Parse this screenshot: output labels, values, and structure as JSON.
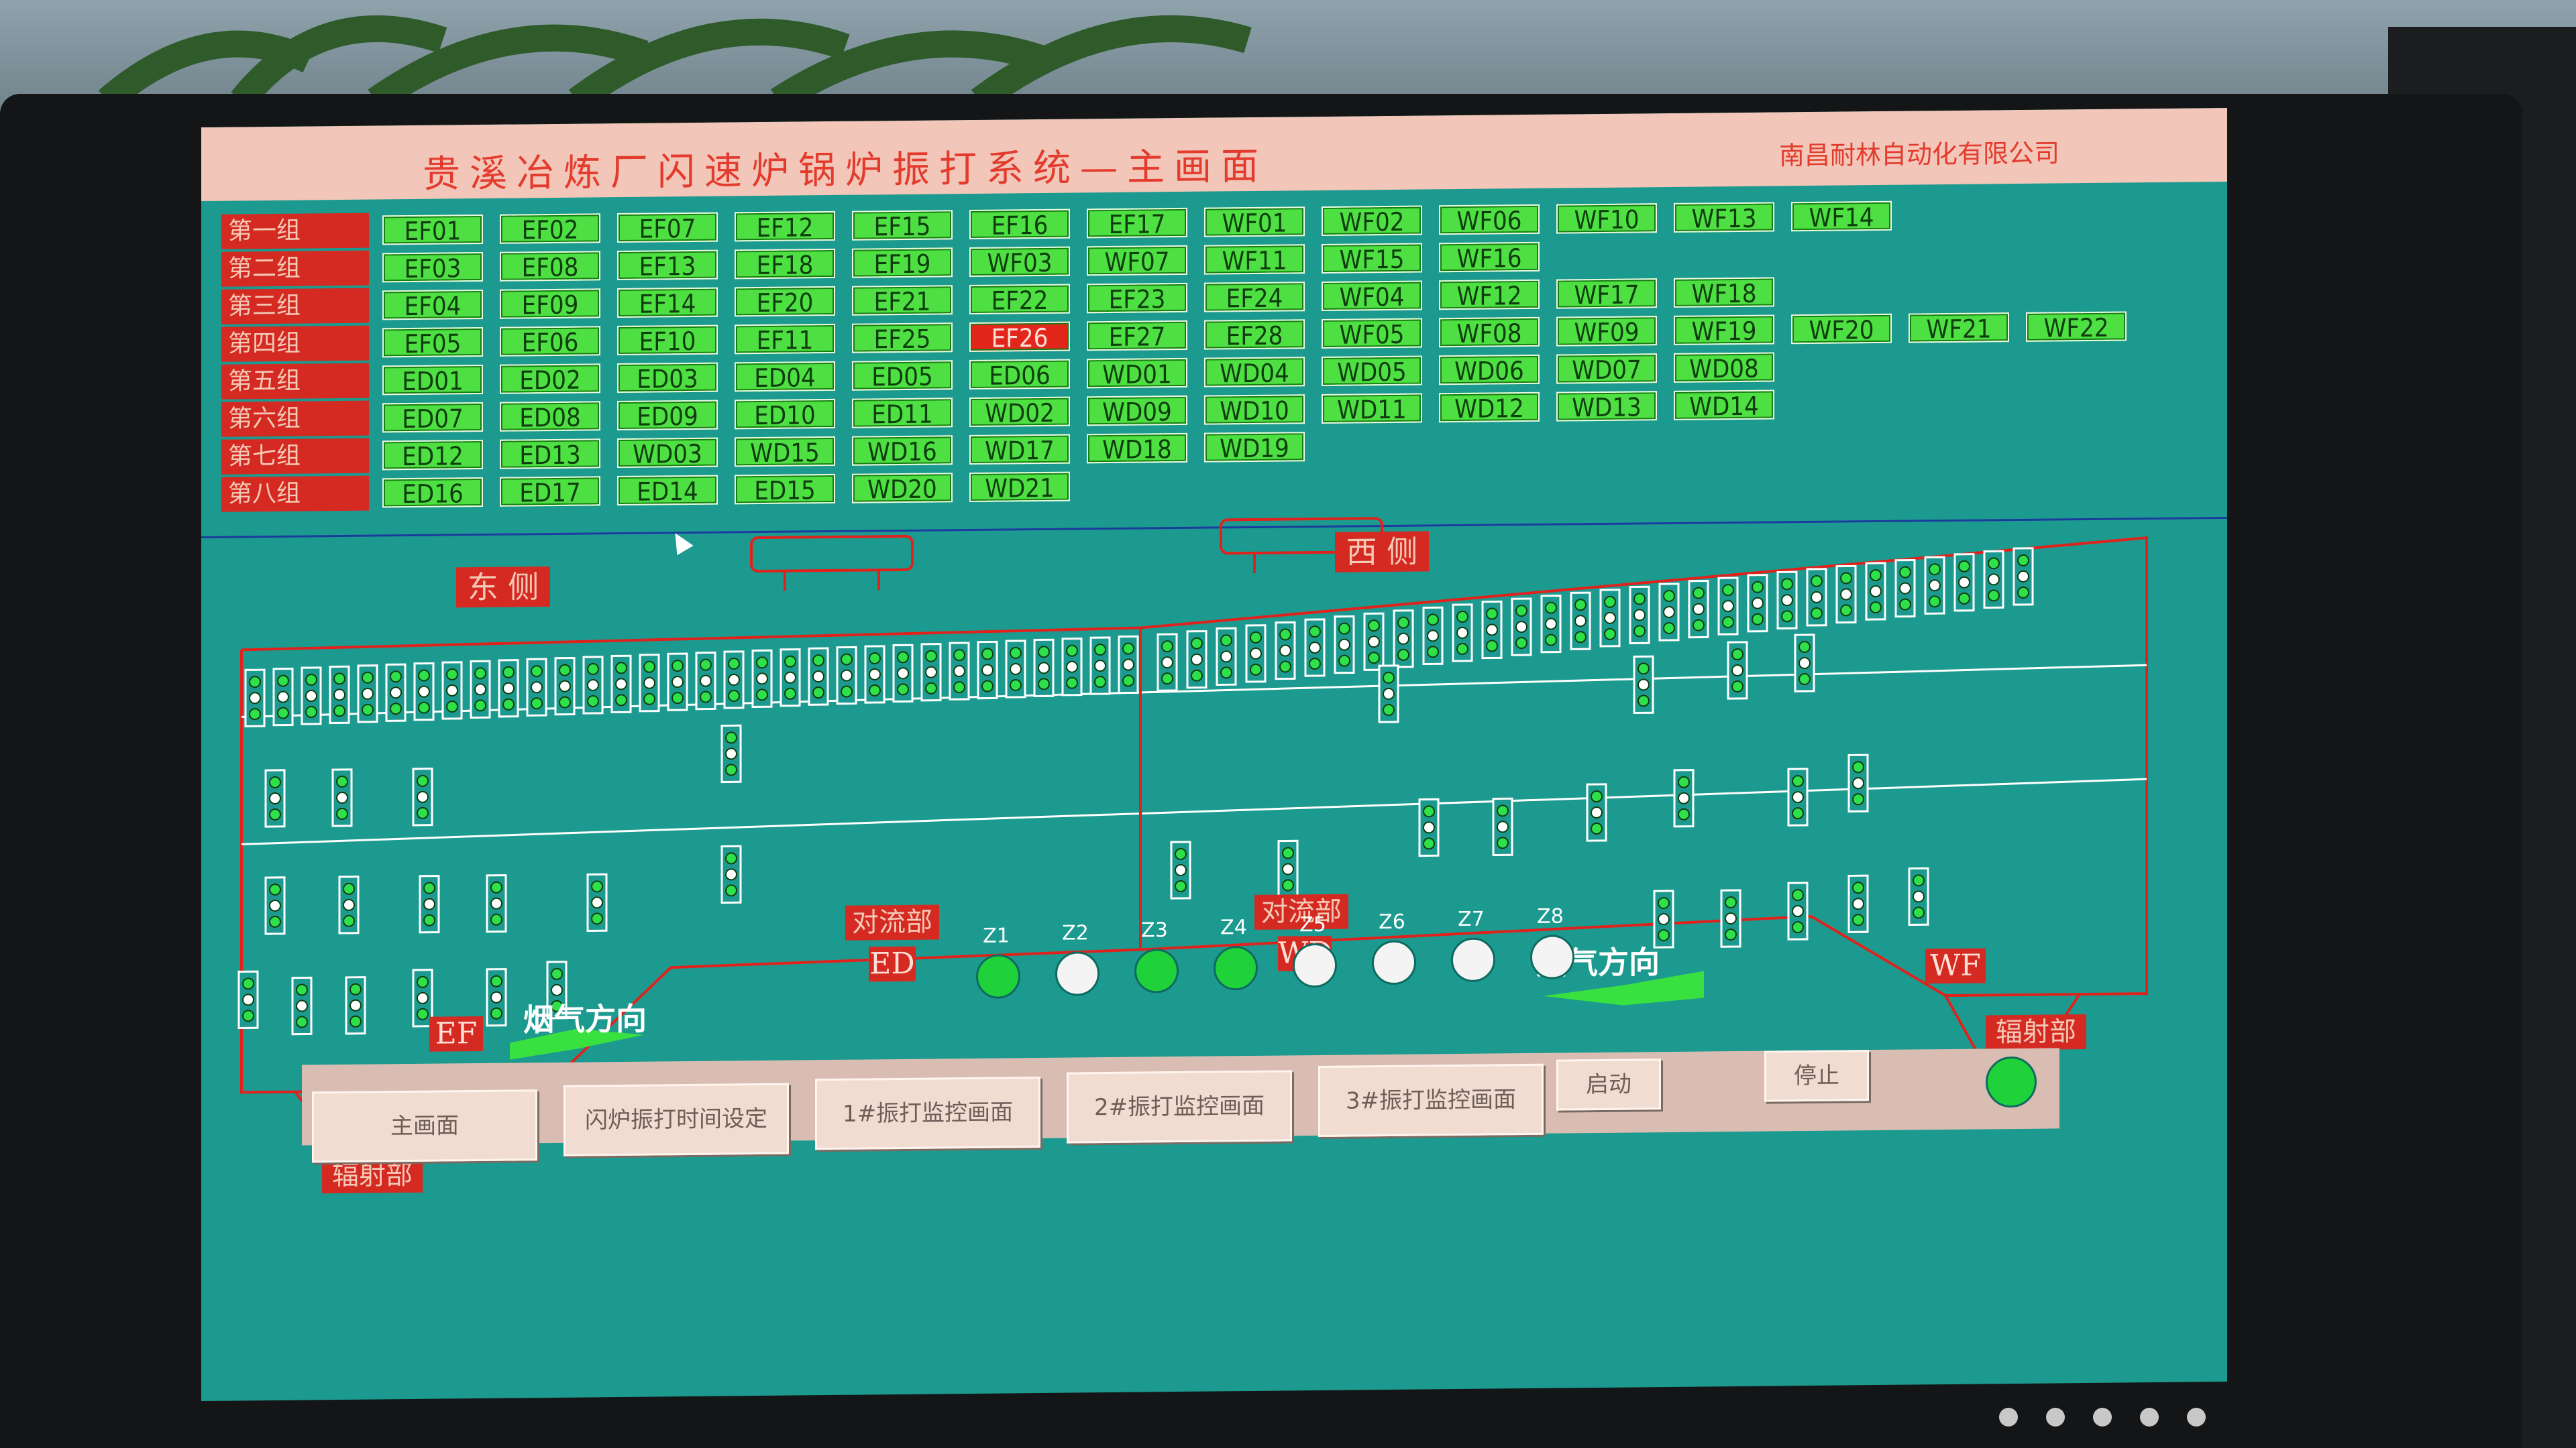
{
  "header": {
    "title": "贵溪冶炼厂闪速炉锅炉振打系统—主画面",
    "company": "南昌耐林自动化有限公司"
  },
  "groups": [
    {
      "label": "第一组",
      "tags": [
        "EF01",
        "EF02",
        "EF07",
        "EF12",
        "EF15",
        "EF16",
        "EF17",
        "WF01",
        "WF02",
        "WF06",
        "WF10",
        "WF13",
        "WF14"
      ]
    },
    {
      "label": "第二组",
      "tags": [
        "EF03",
        "EF08",
        "EF13",
        "EF18",
        "EF19",
        "WF03",
        "WF07",
        "WF11",
        "WF15",
        "WF16"
      ]
    },
    {
      "label": "第三组",
      "tags": [
        "EF04",
        "EF09",
        "EF14",
        "EF20",
        "EF21",
        "EF22",
        "EF23",
        "EF24",
        "WF04",
        "WF12",
        "WF17",
        "WF18"
      ]
    },
    {
      "label": "第四组",
      "tags": [
        "EF05",
        "EF06",
        "EF10",
        "EF11",
        "EF25",
        "EF26",
        "EF27",
        "EF28",
        "WF05",
        "WF08",
        "WF09",
        "WF19",
        "WF20",
        "WF21",
        "WF22"
      ]
    },
    {
      "label": "第五组",
      "tags": [
        "ED01",
        "ED02",
        "ED03",
        "ED04",
        "ED05",
        "ED06",
        "WD01",
        "WD04",
        "WD05",
        "WD06",
        "WD07",
        "WD08"
      ]
    },
    {
      "label": "第六组",
      "tags": [
        "ED07",
        "ED08",
        "ED09",
        "ED10",
        "ED11",
        "WD02",
        "WD09",
        "WD10",
        "WD11",
        "WD12",
        "WD13",
        "WD14"
      ]
    },
    {
      "label": "第七组",
      "tags": [
        "ED12",
        "ED13",
        "WD03",
        "WD15",
        "WD16",
        "WD17",
        "WD18",
        "WD19"
      ]
    },
    {
      "label": "第八组",
      "tags": [
        "ED16",
        "ED17",
        "ED14",
        "ED15",
        "WD20",
        "WD21"
      ]
    }
  ],
  "alarm_tag": "EF26",
  "colors": {
    "ok": "#4ee042",
    "alarm": "#e3261c",
    "screen": "#1d9a8f",
    "line": "#e0221c"
  },
  "diagram": {
    "east_side": "东 侧",
    "west_side": "西 侧",
    "convection_section": "对流部",
    "convection_ed": "ED",
    "convection_section_2": "对流部",
    "convection_wd": "WD",
    "radiation_section_left": "辐射部",
    "radiation_ef": "EF",
    "radiation_section_right": "辐射部",
    "radiation_wf": "WF",
    "gas_direction_left": "烟气方向",
    "gas_direction_right": "烟气方向"
  },
  "zones": [
    {
      "label": "Z1",
      "state": "on"
    },
    {
      "label": "Z2",
      "state": "off"
    },
    {
      "label": "Z3",
      "state": "on"
    },
    {
      "label": "Z4",
      "state": "on"
    },
    {
      "label": "Z5",
      "state": "off"
    },
    {
      "label": "Z6",
      "state": "off"
    },
    {
      "label": "Z7",
      "state": "off"
    },
    {
      "label": "Z8",
      "state": "off"
    }
  ],
  "nav_buttons": [
    "主画面",
    "闪炉振打时间设定",
    "1#振打监控画面",
    "2#振打监控画面",
    "3#振打监控画面"
  ],
  "control": {
    "start": "启动",
    "stop": "停止",
    "status_label": "",
    "running": true
  }
}
